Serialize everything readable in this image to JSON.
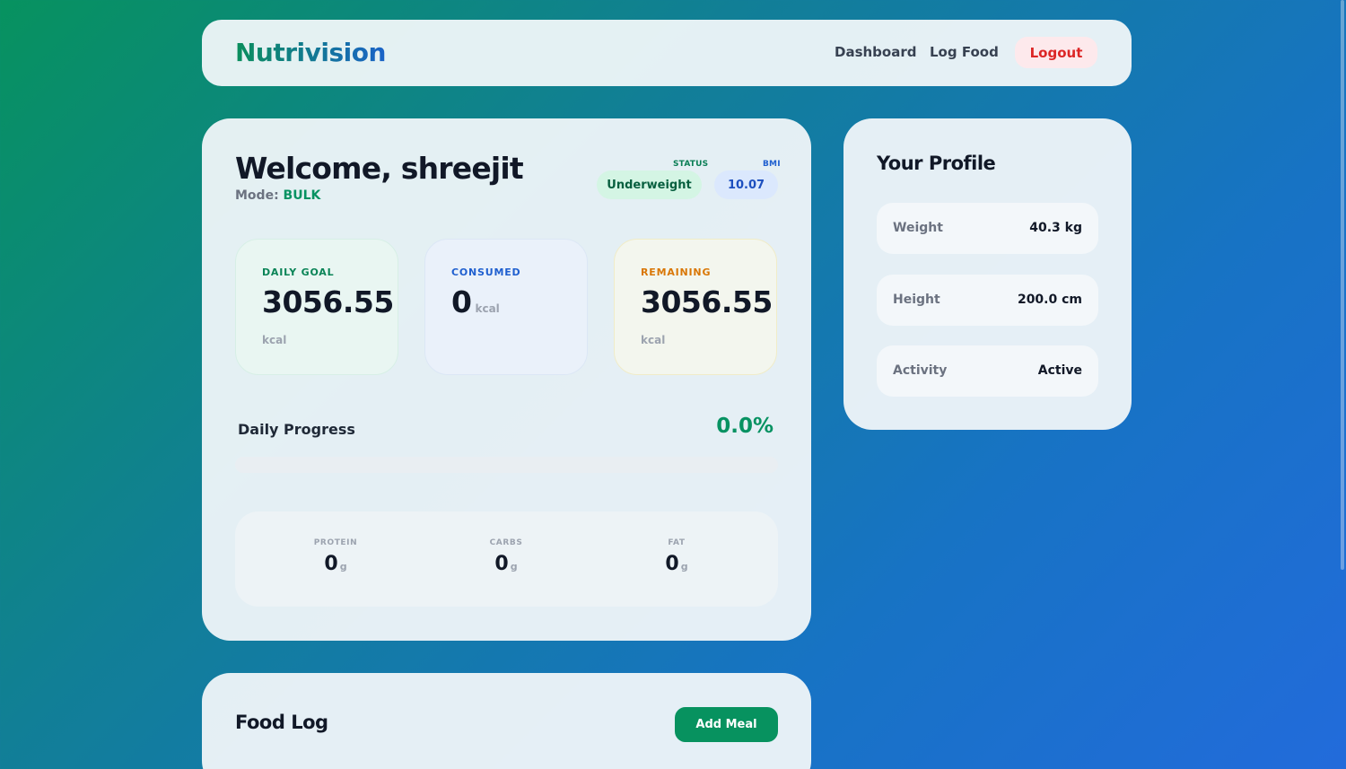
{
  "navbar": {
    "brand": "Nutrivision",
    "links": {
      "dashboard": "Dashboard",
      "log_food": "Log Food"
    },
    "logout_label": "Logout"
  },
  "welcome": {
    "greeting": "Welcome, shreejit",
    "mode_label": "Mode:",
    "mode_value": "BULK",
    "status_label": "STATUS",
    "status_value": "Underweight",
    "bmi_label": "BMI",
    "bmi_value": "10.07"
  },
  "stats": {
    "daily_goal": {
      "label": "DAILY GOAL",
      "value": "3056.55",
      "unit": "kcal"
    },
    "consumed": {
      "label": "CONSUMED",
      "value": "0",
      "unit": "kcal"
    },
    "remaining": {
      "label": "REMAINING",
      "value": "3056.55",
      "unit": "kcal"
    }
  },
  "progress": {
    "label": "Daily Progress",
    "percent_text": "0.0%",
    "fraction": 0.0
  },
  "macros": {
    "protein": {
      "label": "PROTEIN",
      "value": "0",
      "unit": "g"
    },
    "carbs": {
      "label": "CARBS",
      "value": "0",
      "unit": "g"
    },
    "fat": {
      "label": "FAT",
      "value": "0",
      "unit": "g"
    }
  },
  "profile": {
    "title": "Your Profile",
    "weight": {
      "label": "Weight",
      "value": "40.3 kg"
    },
    "height": {
      "label": "Height",
      "value": "200.0 cm"
    },
    "activity": {
      "label": "Activity",
      "value": "Active"
    }
  },
  "food_log": {
    "title": "Food Log",
    "add_meal_label": "Add Meal"
  },
  "colors": {
    "brand_green": "#079262",
    "brand_blue": "#1f5fcf",
    "warning_orange": "#d97706",
    "danger_red": "#dc2626"
  }
}
